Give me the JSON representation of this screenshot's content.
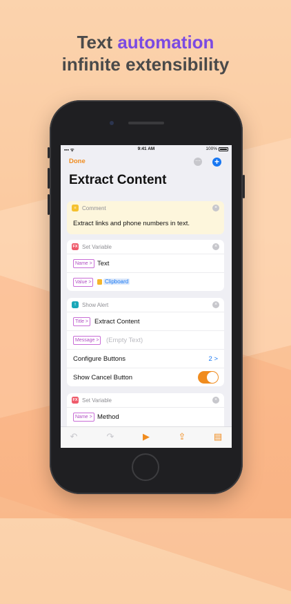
{
  "headline": {
    "line1_prefix": "Text ",
    "line1_highlight": "automation",
    "line2": "infinite extensibility"
  },
  "status_bar": {
    "carrier": "▪▪▪ ᯤ",
    "time": "9:41 AM",
    "battery": "100%"
  },
  "navbar": {
    "done_label": "Done",
    "more_icon": "⋯",
    "add_icon": "+"
  },
  "page_title": "Extract Content",
  "cards": {
    "comment": {
      "icon": "≡",
      "header": "Comment",
      "close": "×",
      "text": "Extract links and phone numbers in text."
    },
    "set_var1": {
      "icon": "FX",
      "header": "Set Variable",
      "close": "×",
      "name_param": "Name >",
      "name_value": "Text",
      "value_param": "Value >",
      "value_token": "Clipboard"
    },
    "alert": {
      "icon": "!",
      "header": "Show Alert",
      "close": "×",
      "title_param": "Title >",
      "title_value": "Extract Content",
      "message_param": "Message >",
      "message_placeholder": "(Empty Text)",
      "buttons_label": "Configure Buttons",
      "buttons_count": "2 >",
      "cancel_label": "Show Cancel Button",
      "cancel_on": true
    },
    "set_var2": {
      "icon": "FX",
      "header": "Set Variable",
      "close": "×",
      "name_param": "Name >",
      "name_value": "Method"
    }
  },
  "toolbar": {
    "undo_icon": "↶",
    "redo_icon": "↷",
    "run_icon": "▶",
    "share_icon": "⇪",
    "doc_icon": "▤"
  },
  "colors": {
    "accent": "#f08c1f",
    "blue": "#1877f2",
    "headline_highlight": "#7b4ae2",
    "param": "#b04dc2"
  }
}
